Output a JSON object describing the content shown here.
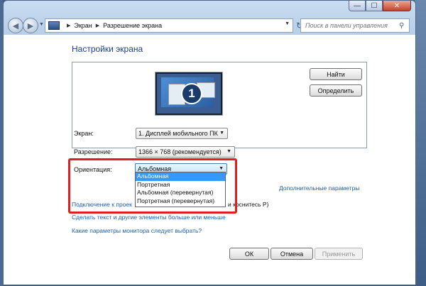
{
  "window": {
    "controls": {
      "minimize": "—",
      "maximize": "☐",
      "close": "✕"
    }
  },
  "nav": {
    "breadcrumb": [
      "Экран",
      "Разрешение экрана"
    ],
    "search_placeholder": "Поиск в панели управления"
  },
  "main": {
    "title": "Настройки экрана",
    "monitor_number": "1",
    "find_button": "Найти",
    "identify_button": "Определить",
    "screen_label": "Экран:",
    "screen_value": "1. Дисплей мобильного ПК",
    "resolution_label": "Разрешение:",
    "resolution_value": "1366 × 768 (рекомендуется)",
    "orientation_label": "Ориентация:",
    "orientation_value": "Альбомная",
    "orientation_options": [
      "Альбомная",
      "Портретная",
      "Альбомная (перевернутая)",
      "Портретная (перевернутая)"
    ],
    "advanced_link": "Дополнительные параметры",
    "projector_link_start": "Подключение к проек",
    "projector_link_end": "и коснитесь P)",
    "text_size_link": "Сделать текст и другие элементы больше или меньше",
    "monitor_help_link": "Какие параметры монитора следует выбрать?",
    "ok_button": "ОК",
    "cancel_button": "Отмена",
    "apply_button": "Применить"
  },
  "colors": {
    "accent": "#1e3f8a",
    "link": "#1a5fb4",
    "selection": "#3399ff",
    "highlight": "#e02020"
  },
  "icons": [
    "back-arrow-icon",
    "forward-arrow-icon",
    "control-panel-icon",
    "refresh-icon",
    "search-icon",
    "dropdown-arrow-icon"
  ]
}
